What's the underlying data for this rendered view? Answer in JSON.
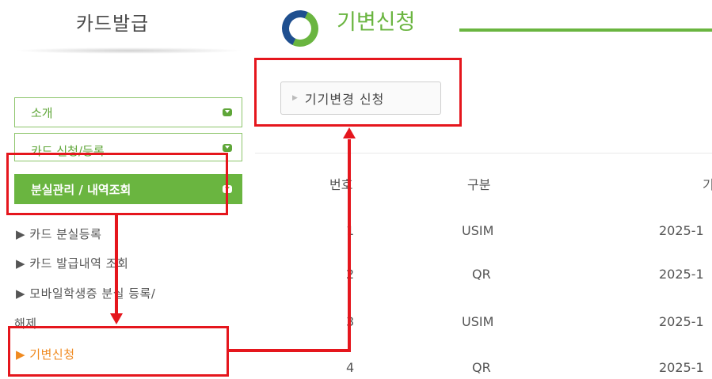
{
  "sidebar": {
    "title": "카드발급",
    "menu": [
      {
        "label": "소개"
      },
      {
        "label": "카드 신청/등록"
      },
      {
        "label": "분실관리 / 내역조회"
      }
    ],
    "sub_items": [
      "▶ 카드 분실등록",
      "▶ 카드 발급내역 조회",
      "▶ 모바일학생증 분실 등록/",
      "해제",
      "▶ 기변신청"
    ]
  },
  "main": {
    "title": "기변신청",
    "request_button_label": "기기변경 신청",
    "table": {
      "headers": [
        "번호",
        "구분",
        "기"
      ],
      "rows": [
        [
          "1",
          "USIM",
          "2025-1"
        ],
        [
          "2",
          "QR",
          "2025-1"
        ],
        [
          "3",
          "USIM",
          "2025-1"
        ],
        [
          "4",
          "QR",
          "2025-1"
        ]
      ]
    }
  },
  "colors": {
    "accent_green": "#6ab540",
    "highlight_red": "#e5161d",
    "current_orange": "#f08a20",
    "icon_blue": "#1f4f8f"
  }
}
